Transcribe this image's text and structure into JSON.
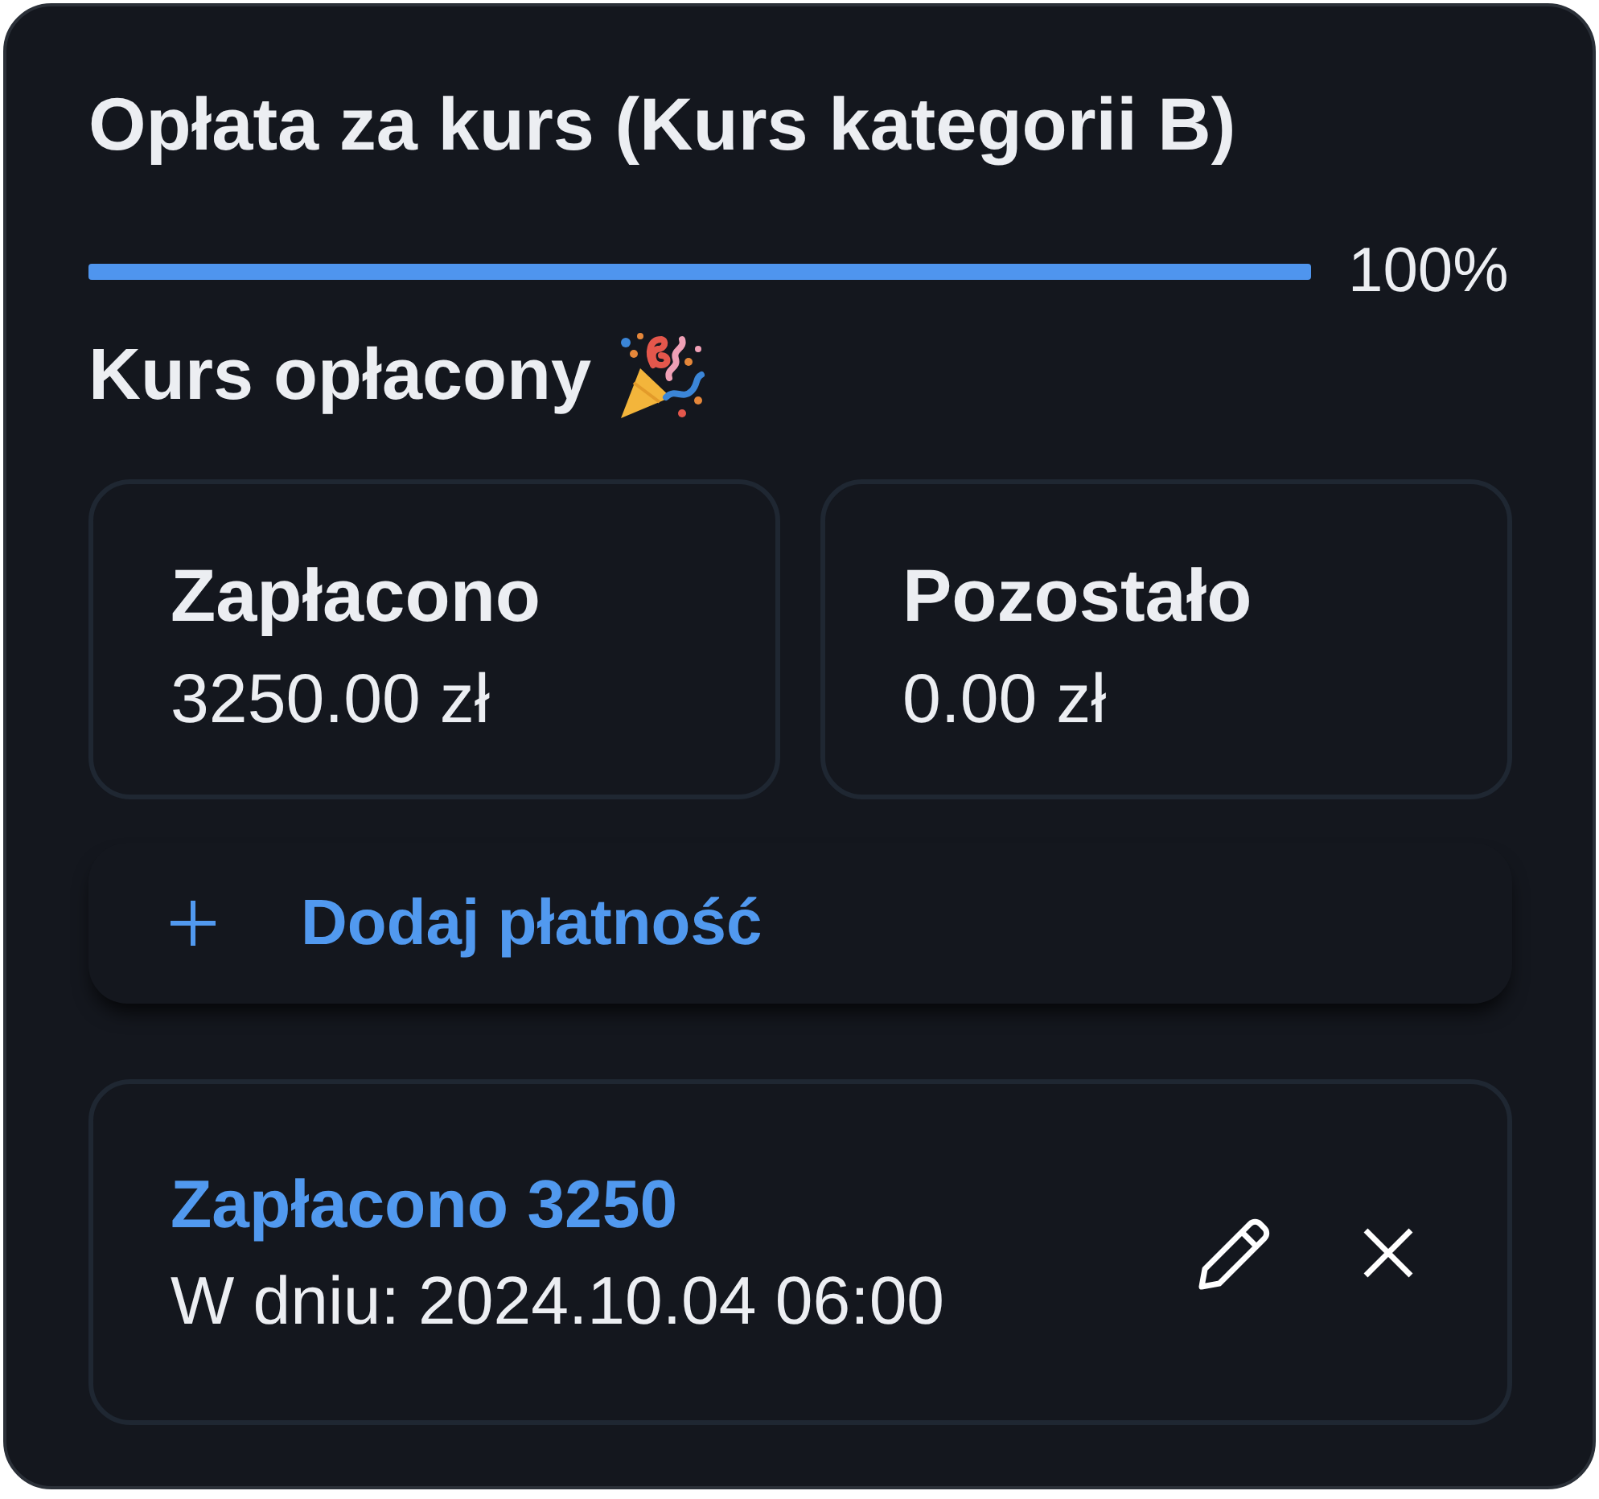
{
  "card": {
    "title": "Opłata za kurs (Kurs kategorii B)"
  },
  "progress": {
    "level": 1,
    "reading": "100%"
  },
  "status": {
    "text": "Kurs opłacony"
  },
  "summary": [
    {
      "label": "Zapłacono",
      "value": "3250.00 zł"
    },
    {
      "label": "Pozostało",
      "value": "0.00 zł"
    }
  ],
  "add_payment": {
    "label": "Dodaj płatność"
  },
  "payments": [
    {
      "title": "Zapłacono 3250",
      "date": "W dniu: 2024.10.04 06:00"
    }
  ]
}
